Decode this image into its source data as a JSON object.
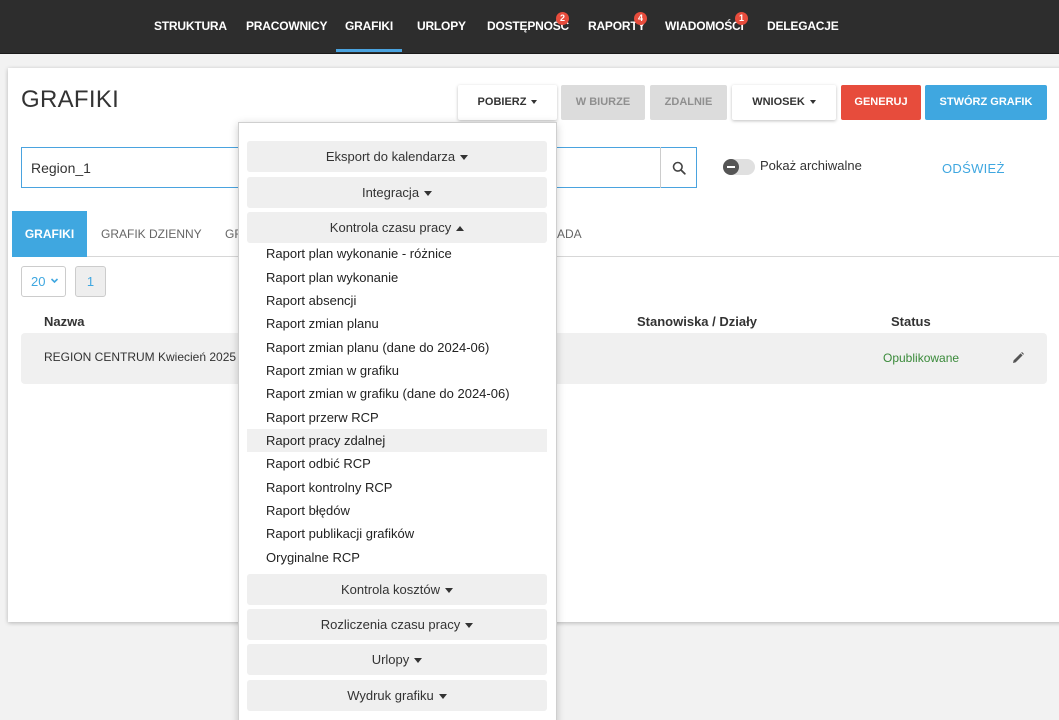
{
  "nav": {
    "items": [
      {
        "label": "STRUKTURA",
        "badge": ""
      },
      {
        "label": "PRACOWNICY",
        "badge": ""
      },
      {
        "label": "GRAFIKI",
        "badge": ""
      },
      {
        "label": "URLOPY",
        "badge": ""
      },
      {
        "label": "DOSTĘPNOŚĆ",
        "badge": "2"
      },
      {
        "label": "RAPORTY",
        "badge": "4"
      },
      {
        "label": "WIADOMOŚCI",
        "badge": "1"
      },
      {
        "label": "DELEGACJE",
        "badge": ""
      }
    ],
    "active": "GRAFIKI",
    "accent_color": "#4aa3df",
    "badge_color": "#e74c3c"
  },
  "page": {
    "title": "GRAFIKI"
  },
  "toolbar": {
    "pobierz_label": "POBIERZ",
    "w_biurze_label": "W BIURZE",
    "zdalnie_label": "ZDALNIE",
    "wniosek_label": "WNIOSEK",
    "generuj_label": "GENERUJ",
    "stworz_label": "STWÓRZ GRAFIK",
    "generuj_color": "#e74c3c",
    "stworz_color": "#3fa7e0"
  },
  "search": {
    "value": "Region_1",
    "icon": "search-icon"
  },
  "archive_toggle": {
    "label": "Pokaż archiwalne",
    "checked": false
  },
  "refresh_label": "ODŚWIEŻ",
  "tabs": [
    {
      "label": "GRAFIKI",
      "active": true
    },
    {
      "label": "GRAFIK DZIENNY",
      "active": false
    },
    {
      "label": "GR",
      "active": false
    },
    {
      "label": "ADA",
      "active": false
    }
  ],
  "pagination": {
    "page_size": "20",
    "current_page": "1"
  },
  "table": {
    "headers": {
      "name": "Nazwa",
      "positions": "Stanowiska / Działy",
      "status": "Status"
    },
    "rows": [
      {
        "name": "REGION CENTRUM Kwiecień 2025",
        "positions": "",
        "status": "Opublikowane",
        "status_color": "#3a8a3a"
      }
    ]
  },
  "dropdown": {
    "sections_top": [
      {
        "label": "Eksport do kalendarza",
        "expanded": false
      },
      {
        "label": "Integracja",
        "expanded": false
      },
      {
        "label": "Kontrola czasu pracy",
        "expanded": true
      }
    ],
    "items": [
      "Raport plan wykonanie - różnice",
      "Raport plan wykonanie",
      "Raport absencji",
      "Raport zmian planu",
      "Raport zmian planu (dane do 2024-06)",
      "Raport zmian w grafiku",
      "Raport zmian w grafiku (dane do 2024-06)",
      "Raport przerw RCP",
      "Raport pracy zdalnej",
      "Raport odbić RCP",
      "Raport kontrolny RCP",
      "Raport błędów",
      "Raport publikacji grafików",
      "Oryginalne RCP"
    ],
    "hovered_item": "Raport pracy zdalnej",
    "sections_bottom": [
      {
        "label": "Kontrola kosztów",
        "expanded": false
      },
      {
        "label": "Rozliczenia czasu pracy",
        "expanded": false
      },
      {
        "label": "Urlopy",
        "expanded": false
      },
      {
        "label": "Wydruk grafiku",
        "expanded": false
      }
    ]
  }
}
